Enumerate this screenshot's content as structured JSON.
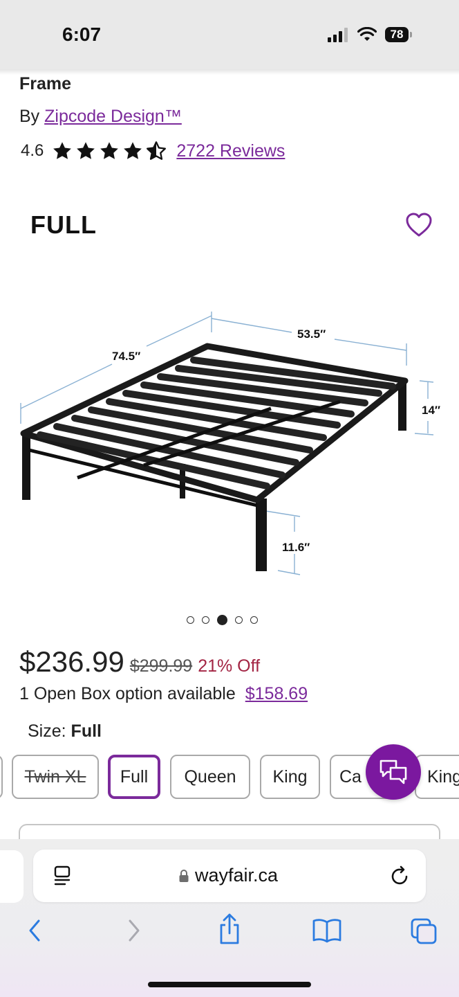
{
  "status_bar": {
    "time": "6:07",
    "battery": "78"
  },
  "product": {
    "title_tail": "Frame",
    "brand_prefix": "By ",
    "brand": "Zipcode Design™",
    "rating": "4.6",
    "stars_filled": 4.5,
    "reviews": "2722 Reviews"
  },
  "gallery": {
    "size_heading": "FULL",
    "dimensions": {
      "length": "74.5″",
      "width": "53.5″",
      "height": "14″",
      "clearance": "11.6″"
    },
    "dots_count": 5,
    "active_dot": 3
  },
  "pricing": {
    "price": "$236.99",
    "old_price": "$299.99",
    "discount": "21% Off",
    "open_box_text": "1 Open Box option available",
    "open_box_price": "$158.69"
  },
  "size_selector": {
    "label": "Size:",
    "selected": "Full",
    "options": [
      "Twin XL",
      "Full",
      "Queen",
      "King",
      "Ca",
      "King"
    ]
  },
  "browser": {
    "url": "wayfair.ca"
  },
  "colors": {
    "brand_purple": "#7b2a9b",
    "chat_purple": "#7b189f",
    "discount_red": "#a32443"
  }
}
